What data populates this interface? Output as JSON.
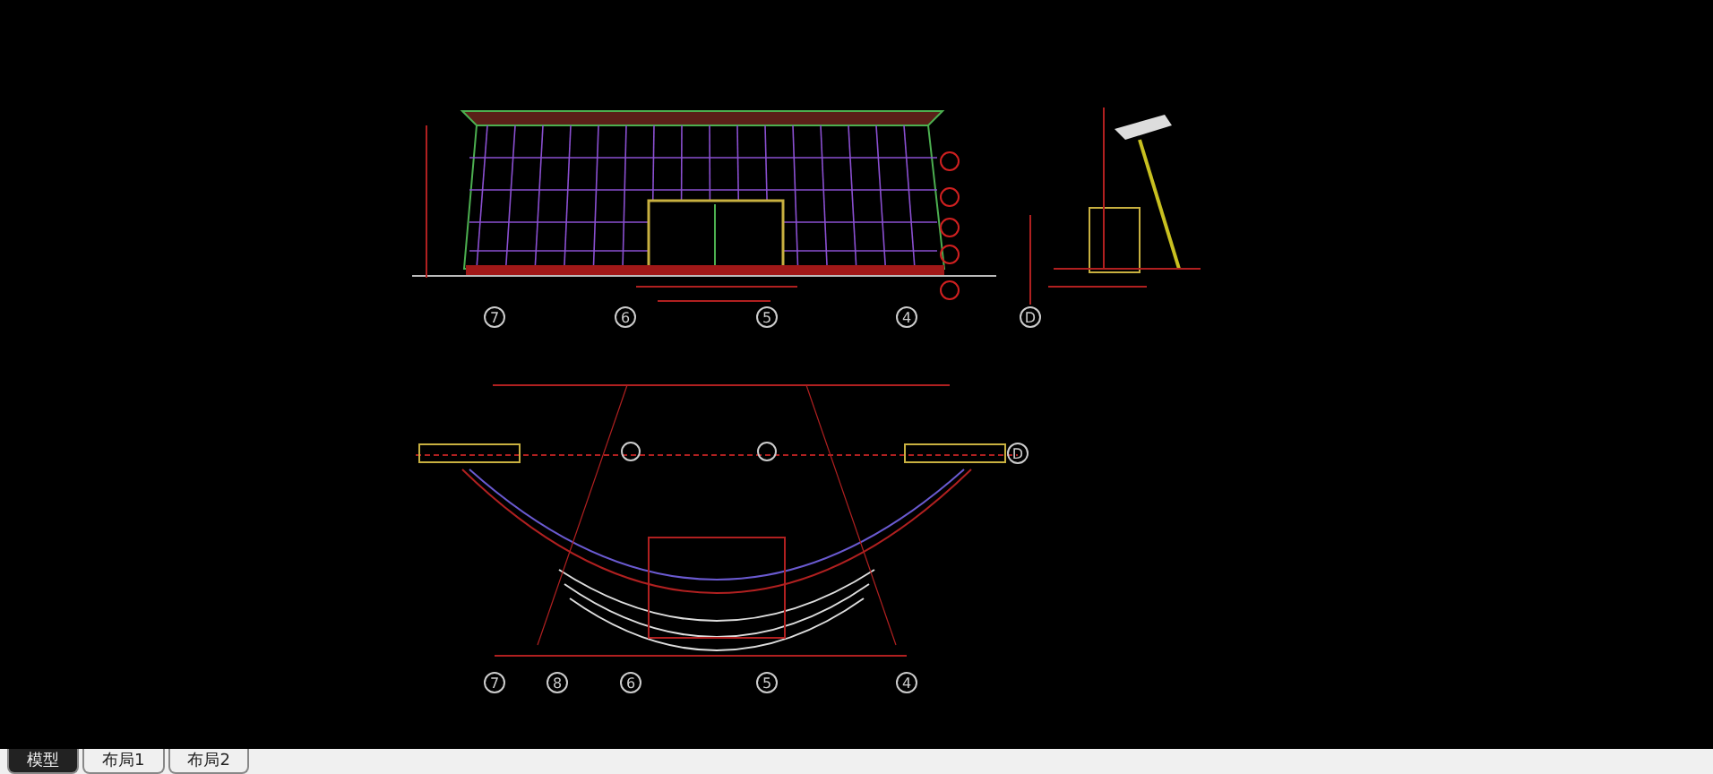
{
  "elevation": {
    "axes": [
      "7",
      "6",
      "5",
      "4"
    ]
  },
  "section": {
    "axes": [
      "D"
    ]
  },
  "plan": {
    "axes": [
      "7",
      "8",
      "6",
      "5",
      "4"
    ],
    "side_axes": [
      "D"
    ]
  },
  "tabs": [
    {
      "label": "模型",
      "selected": true
    },
    {
      "label": "布局1",
      "selected": false
    },
    {
      "label": "布局2",
      "selected": false
    }
  ]
}
